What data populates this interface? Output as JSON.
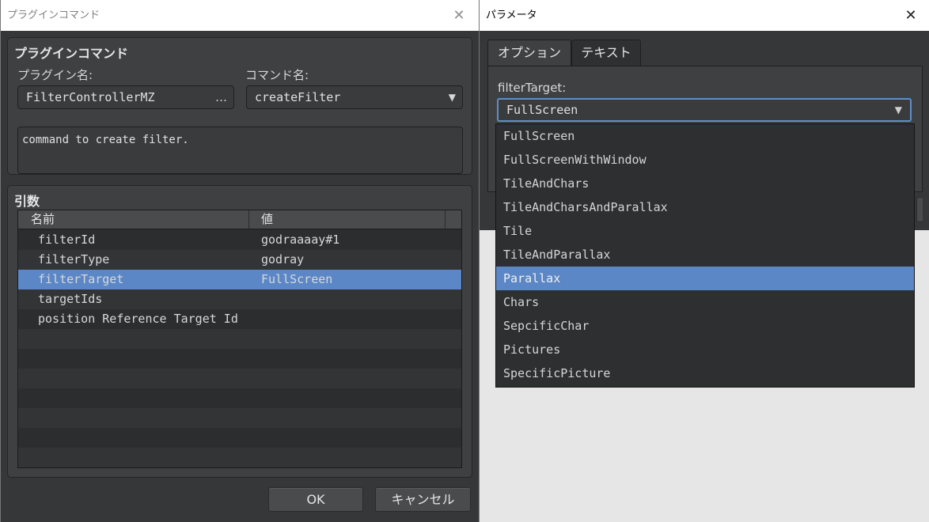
{
  "left_dialog": {
    "title": "プラグインコマンド",
    "group_title": "プラグインコマンド",
    "plugin_label": "プラグイン名:",
    "plugin_value": "FilterControllerMZ",
    "plugin_more": "…",
    "command_label": "コマンド名:",
    "command_value": "createFilter",
    "description": "command to create filter.",
    "args_title": "引数",
    "columns": [
      "名前",
      "値"
    ],
    "rows": [
      {
        "name": "filterId",
        "value": "godraaaay#1"
      },
      {
        "name": "filterType",
        "value": "godray"
      },
      {
        "name": "filterTarget",
        "value": "FullScreen",
        "selected": true
      },
      {
        "name": "targetIds",
        "value": ""
      },
      {
        "name": "position Reference Target Id",
        "value": ""
      },
      {
        "name": "",
        "value": ""
      },
      {
        "name": "",
        "value": ""
      },
      {
        "name": "",
        "value": ""
      },
      {
        "name": "",
        "value": ""
      },
      {
        "name": "",
        "value": ""
      },
      {
        "name": "",
        "value": ""
      },
      {
        "name": "",
        "value": ""
      }
    ],
    "ok_label": "OK",
    "cancel_label": "キャンセル"
  },
  "right_dialog": {
    "title": "パラメータ",
    "tabs": [
      {
        "label": "オプション",
        "active": true
      },
      {
        "label": "テキスト",
        "active": false
      }
    ],
    "field_label": "filterTarget:",
    "combo_value": "FullScreen",
    "options": [
      "FullScreen",
      "FullScreenWithWindow",
      "TileAndChars",
      "TileAndCharsAndParallax",
      "Tile",
      "TileAndParallax",
      "Parallax",
      "Chars",
      "SepcificChar",
      "Pictures",
      "SpecificPicture"
    ],
    "highlighted_option": "Parallax"
  },
  "icons": {
    "close": "close-icon",
    "dropdown": "triangle-down-icon",
    "more": "ellipsis-icon"
  },
  "colors": {
    "selection": "#5b87c6",
    "panel": "#3f4042",
    "focus_border": "#5f8ec8"
  }
}
